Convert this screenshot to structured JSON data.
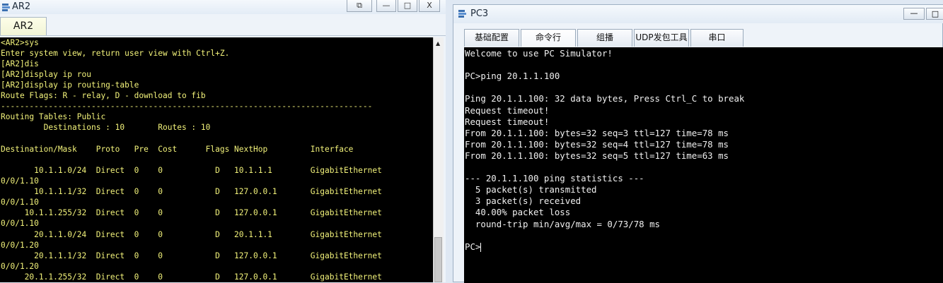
{
  "ar2": {
    "title": "AR2",
    "tab": "AR2",
    "controls": {
      "restore": "⧉",
      "minimize": "—",
      "maximize": "□",
      "close": "X"
    },
    "lines": [
      "<AR2>sys",
      "Enter system view, return user view with Ctrl+Z.",
      "[AR2]dis",
      "[AR2]display ip rou",
      "[AR2]display ip routing-table",
      "Route Flags: R - relay, D - download to fib",
      "------------------------------------------------------------------------------",
      "Routing Tables: Public",
      "         Destinations : 10       Routes : 10",
      "",
      "Destination/Mask    Proto   Pre  Cost      Flags NextHop         Interface",
      "",
      "       10.1.1.0/24  Direct  0    0           D   10.1.1.1        GigabitEthernet",
      "0/0/1.10",
      "       10.1.1.1/32  Direct  0    0           D   127.0.0.1       GigabitEthernet",
      "0/0/1.10",
      "     10.1.1.255/32  Direct  0    0           D   127.0.0.1       GigabitEthernet",
      "0/0/1.10",
      "       20.1.1.0/24  Direct  0    0           D   20.1.1.1        GigabitEthernet",
      "0/0/1.20",
      "       20.1.1.1/32  Direct  0    0           D   127.0.0.1       GigabitEthernet",
      "0/0/1.20",
      "     20.1.1.255/32  Direct  0    0           D   127.0.0.1       GigabitEthernet"
    ]
  },
  "pc3": {
    "title": "PC3",
    "controls": {
      "minimize": "—",
      "maximize": "□"
    },
    "tabs": [
      "基础配置",
      "命令行",
      "组播",
      "UDP发包工具",
      "串口"
    ],
    "active_tab": "命令行",
    "lines": [
      "Welcome to use PC Simulator!",
      "",
      "PC>ping 20.1.1.100",
      "",
      "Ping 20.1.1.100: 32 data bytes, Press Ctrl_C to break",
      "Request timeout!",
      "Request timeout!",
      "From 20.1.1.100: bytes=32 seq=3 ttl=127 time=78 ms",
      "From 20.1.1.100: bytes=32 seq=4 ttl=127 time=78 ms",
      "From 20.1.1.100: bytes=32 seq=5 ttl=127 time=63 ms",
      "",
      "--- 20.1.1.100 ping statistics ---",
      "  5 packet(s) transmitted",
      "  3 packet(s) received",
      "  40.00% packet loss",
      "  round-trip min/avg/max = 0/73/78 ms",
      "",
      "PC>"
    ]
  },
  "colors": {
    "terminal_bg": "#000000",
    "ar2_text": "#f2f27a",
    "pc3_text": "#f0f0f0",
    "window_bg": "#eef3f9"
  }
}
